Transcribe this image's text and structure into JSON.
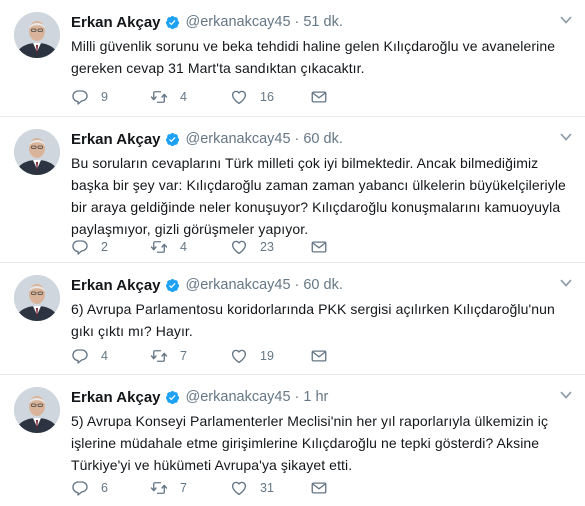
{
  "colors": {
    "name": "#14171a",
    "secondary": "#657786",
    "verified": "#1da1f2",
    "divider": "#e6ecf0"
  },
  "icons": {
    "reply": "reply-icon",
    "retweet": "retweet-icon",
    "like": "heart-icon",
    "message": "envelope-icon",
    "verified": "verified-badge-icon",
    "caret": "chevron-down-icon"
  },
  "tweets": [
    {
      "author": "Erkan Akçay",
      "handle": "@erkanakcay45",
      "separator": "·",
      "time": "51 dk.",
      "text": "Milli güvenlik sorunu ve beka tehdidi haline gelen Kılıçdaroğlu ve avanelerine gereken cevap 31 Mart'ta sandıktan çıkacaktır.",
      "replies": "9",
      "retweets": "4",
      "likes": "16"
    },
    {
      "author": "Erkan Akçay",
      "handle": "@erkanakcay45",
      "separator": "·",
      "time": "60 dk.",
      "text": "Bu soruların cevaplarını Türk milleti çok iyi bilmektedir. Ancak bilmediğimiz başka bir şey var: Kılıçdaroğlu zaman zaman yabancı ülkelerin büyükelçileriyle bir araya geldiğinde neler konuşuyor? Kılıçdaroğlu konuşmalarını kamuoyuyla paylaşmıyor, gizli görüşmeler yapıyor.",
      "replies": "2",
      "retweets": "4",
      "likes": "23"
    },
    {
      "author": "Erkan Akçay",
      "handle": "@erkanakcay45",
      "separator": "·",
      "time": "60 dk.",
      "text": "6) Avrupa Parlamentosu koridorlarında PKK sergisi açılırken Kılıçdaroğlu'nun gıkı çıktı mı? Hayır.",
      "replies": "4",
      "retweets": "7",
      "likes": "19"
    },
    {
      "author": "Erkan Akçay",
      "handle": "@erkanakcay45",
      "separator": "·",
      "time": "1 hr",
      "text": "5) Avrupa Konseyi Parlamenterler Meclisi'nin her yıl raporlarıyla ülkemizin iç işlerine müdahale etme girişimlerine Kılıçdaroğlu ne tepki gösterdi? Aksine Türkiye'yi ve hükümeti Avrupa'ya şikayet etti.",
      "replies": "6",
      "retweets": "7",
      "likes": "31"
    }
  ]
}
